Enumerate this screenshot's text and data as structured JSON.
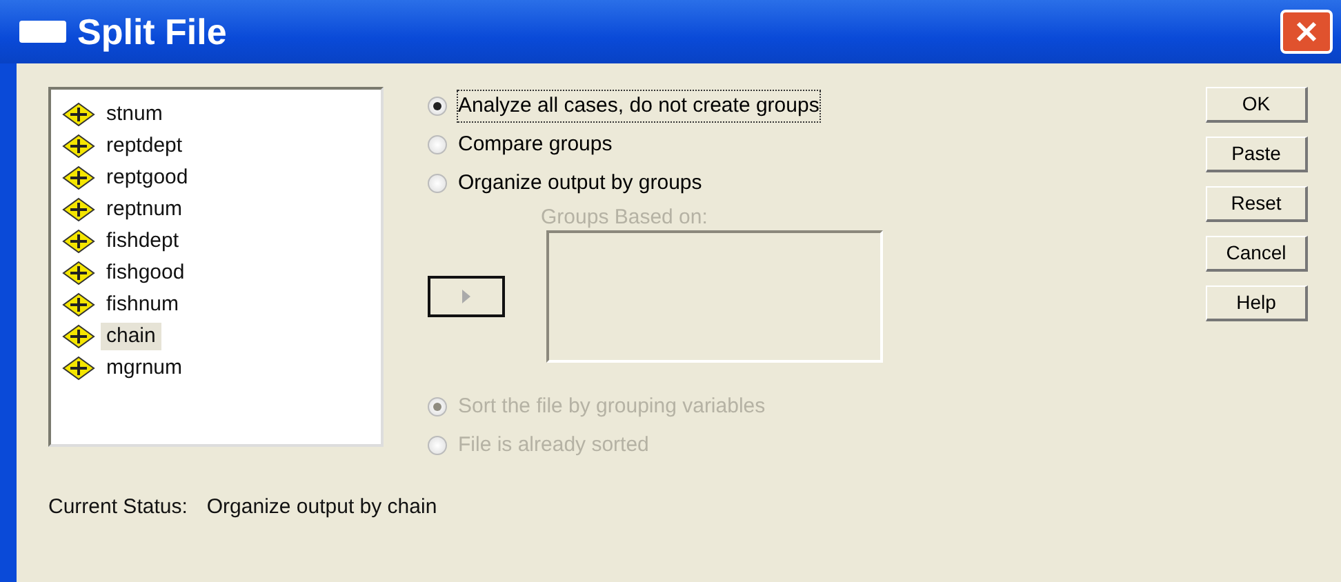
{
  "window": {
    "title": "Split File"
  },
  "variables": [
    {
      "name": "stnum",
      "selected": false
    },
    {
      "name": "reptdept",
      "selected": false
    },
    {
      "name": "reptgood",
      "selected": false
    },
    {
      "name": "reptnum",
      "selected": false
    },
    {
      "name": "fishdept",
      "selected": false
    },
    {
      "name": "fishgood",
      "selected": false
    },
    {
      "name": "fishnum",
      "selected": false
    },
    {
      "name": "chain",
      "selected": true
    },
    {
      "name": "mgrnum",
      "selected": false
    }
  ],
  "mode_options": [
    {
      "label": "Analyze all cases, do not create groups",
      "selected": true,
      "disabled": false
    },
    {
      "label": "Compare groups",
      "selected": false,
      "disabled": false
    },
    {
      "label": "Organize output by groups",
      "selected": false,
      "disabled": false
    }
  ],
  "groups_based_on": {
    "label": "Groups Based on:",
    "disabled": true
  },
  "sort_options": [
    {
      "label": "Sort the file by grouping variables",
      "selected": true,
      "disabled": true
    },
    {
      "label": "File is already sorted",
      "selected": false,
      "disabled": true
    }
  ],
  "buttons": [
    "OK",
    "Paste",
    "Reset",
    "Cancel",
    "Help"
  ],
  "status": {
    "label": "Current Status:",
    "value": "Organize output by chain"
  }
}
